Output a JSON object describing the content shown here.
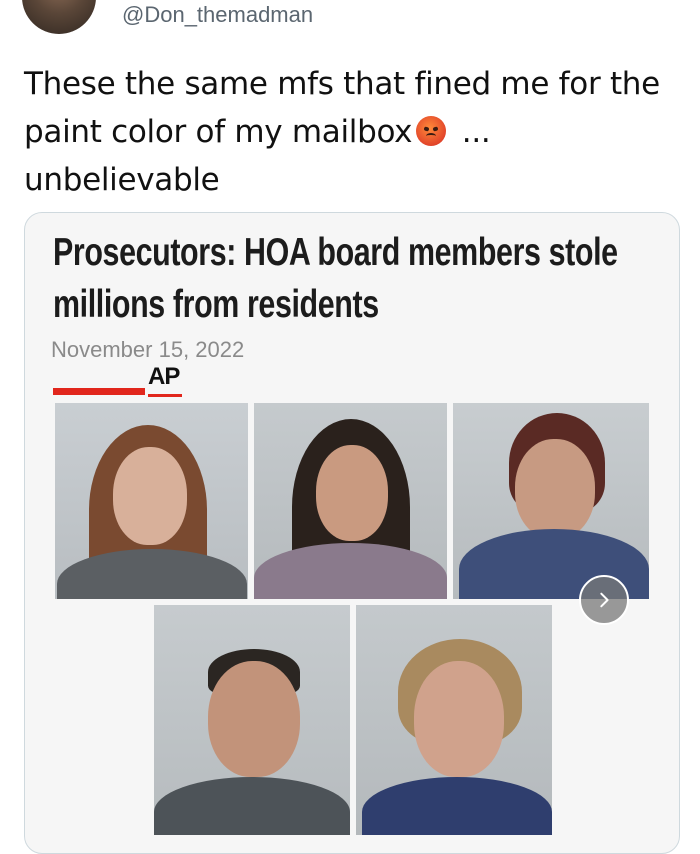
{
  "tweet": {
    "handle": "@Don_themadman",
    "text_part1": "These the same mfs that fined me for the paint color of my mailbox",
    "emoji": "angry-face-emoji",
    "text_part2": " ... unbelievable"
  },
  "card": {
    "headline": "Prosecutors: HOA board members stole millions from residents",
    "date": "November 15, 2022",
    "source_logo": "AP",
    "accent_color": "#e1261c",
    "photos": [
      "mugshot-1",
      "mugshot-2",
      "mugshot-3",
      "mugshot-4",
      "mugshot-5"
    ],
    "next_icon": "chevron-right-icon"
  }
}
